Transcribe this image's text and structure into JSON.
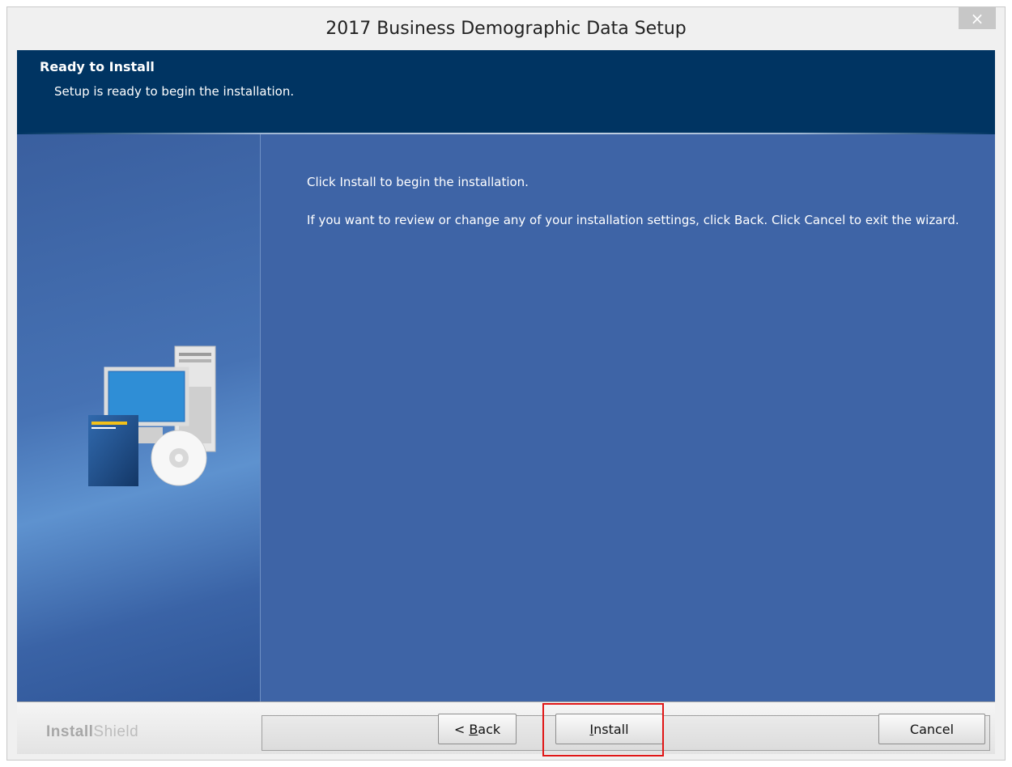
{
  "window": {
    "title": "2017 Business Demographic Data Setup",
    "close_glyph": "×"
  },
  "header": {
    "title": "Ready to Install",
    "subtitle": "Setup is ready to begin the installation."
  },
  "main": {
    "message1": "Click Install to begin the installation.",
    "message2": "If you want to review or change any of your installation settings, click Back. Click Cancel to exit the wizard."
  },
  "footer": {
    "brand_bold": "Install",
    "brand_light": "Shield",
    "back_prefix": "< ",
    "back_mnemonic": "B",
    "back_rest": "ack",
    "install_mnemonic": "I",
    "install_rest": "nstall",
    "cancel_label": "Cancel"
  },
  "colors": {
    "header_bg": "#003462",
    "content_bg": "#3e64a6",
    "highlight": "#e01616"
  },
  "icons": [
    "close-icon",
    "computer-cd-icon"
  ]
}
